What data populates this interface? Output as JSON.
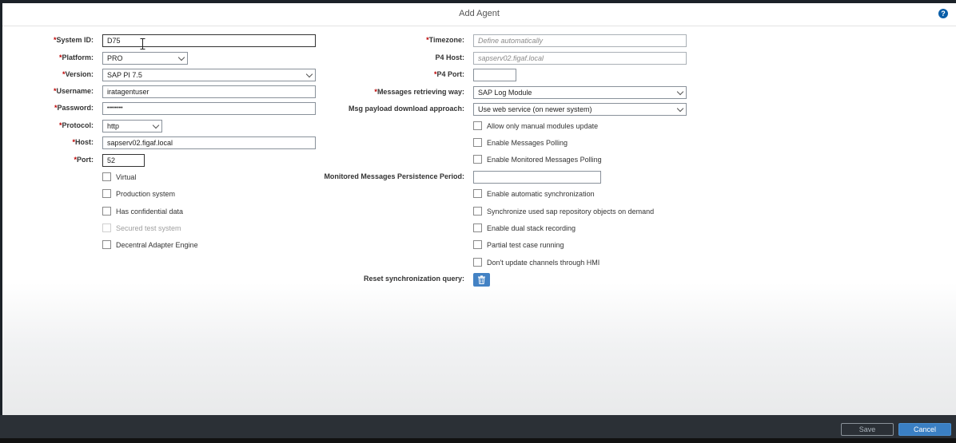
{
  "dialog": {
    "title": "Add Agent",
    "help_glyph": "?"
  },
  "left": {
    "system_id": {
      "label": "System ID:",
      "value": "D75"
    },
    "platform": {
      "label": "Platform:",
      "value": "PRO"
    },
    "version": {
      "label": "Version:",
      "value": "SAP PI 7.5"
    },
    "username": {
      "label": "Username:",
      "value": "iratagentuser"
    },
    "password": {
      "label": "Password:",
      "value": "••••••••"
    },
    "protocol": {
      "label": "Protocol:",
      "value": "http"
    },
    "host": {
      "label": "Host:",
      "value": "sapserv02.figaf.local"
    },
    "port": {
      "label": "Port:",
      "value": "52"
    },
    "checkboxes": [
      "Virtual",
      "Production system",
      "Has confidential data",
      "Secured test system",
      "Decentral Adapter Engine"
    ]
  },
  "right": {
    "timezone": {
      "label": "Timezone:",
      "placeholder": "Define automatically"
    },
    "p4_host": {
      "label": "P4 Host:",
      "placeholder": "sapserv02.figaf.local"
    },
    "p4_port": {
      "label": "P4 Port:",
      "value": ""
    },
    "messages_retrieving": {
      "label": "Messages retrieving way:",
      "value": "SAP Log Module"
    },
    "msg_payload": {
      "label": "Msg payload download approach:",
      "value": "Use web service (on newer system)"
    },
    "checkboxes_a": [
      "Allow only manual modules update",
      "Enable Messages Polling",
      "Enable Monitored Messages Polling"
    ],
    "persistence_period": {
      "label": "Monitored Messages Persistence Period:",
      "value": ""
    },
    "checkboxes_b": [
      "Enable automatic synchronization",
      "Synchronize used sap repository objects on demand",
      "Enable dual stack recording",
      "Partial test case running",
      "Don't update channels through HMI"
    ],
    "reset_query": {
      "label": "Reset synchronization query:"
    }
  },
  "footer": {
    "save_label": "Save",
    "cancel_label": "Cancel"
  },
  "required_mark": "*"
}
